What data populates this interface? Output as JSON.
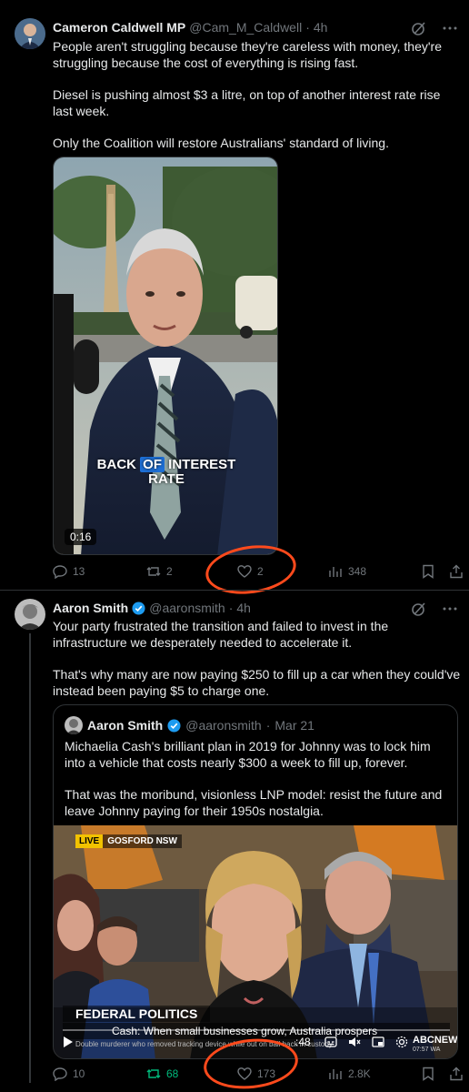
{
  "tweet1": {
    "name": "Cameron Caldwell MP",
    "handle": "@Cam_M_Caldwell",
    "dot": "·",
    "time": "4h",
    "paragraphs": [
      "People aren't struggling because they're careless with money, they're struggling because the cost of everything is rising fast.",
      "Diesel is pushing almost $3 a litre, on top of another interest rate rise last week.",
      "Only the Coalition will restore Australians' standard of living."
    ],
    "video": {
      "caption_line1_a": "BACK ",
      "caption_line1_b": "OF",
      "caption_line1_c": " INTEREST",
      "caption_line2": "RATE",
      "duration": "0:16"
    },
    "stats": {
      "replies": "13",
      "reposts": "2",
      "likes": "2",
      "views": "348"
    }
  },
  "tweet2": {
    "name": "Aaron Smith",
    "handle": "@aaronsmith",
    "dot": "·",
    "time": "4h",
    "paragraphs": [
      "Your party frustrated the transition and failed to invest in the infrastructure we desperately needed to accelerate it.",
      "That's why many are now paying $250 to fill up a car when they could've instead been paying $5 to charge one."
    ],
    "quote": {
      "name": "Aaron Smith",
      "handle": "@aaronsmith",
      "dot": "·",
      "date": "Mar 21",
      "paragraphs": [
        "Michaelia Cash's brilliant plan in 2019 for Johnny was to lock him into a vehicle that costs nearly $300 a week to fill up, forever.",
        "That was the moribund, visionless LNP model: resist the future and leave Johnny paying for their 1950s nostalgia."
      ],
      "video": {
        "live_tag": "LIVE",
        "location": "GOSFORD NSW",
        "banner_title": "FEDERAL POLITICS",
        "banner_headline": "Cash: When small businesses grow, Australia prospers",
        "ticker": "Double murderer who removed tracking device while out on bail back in custody",
        "time_display": ":48",
        "network": "ABCNEWS",
        "clock": "07:57 WA"
      }
    },
    "stats": {
      "replies": "10",
      "reposts": "68",
      "likes": "173",
      "views": "2.8K"
    }
  },
  "colors": {
    "background": "#000000",
    "text": "#e7e9ea",
    "muted": "#71767b",
    "verified": "#1d9bf0",
    "repost_active": "#00ba7c",
    "annotation": "#ff4a1c"
  }
}
